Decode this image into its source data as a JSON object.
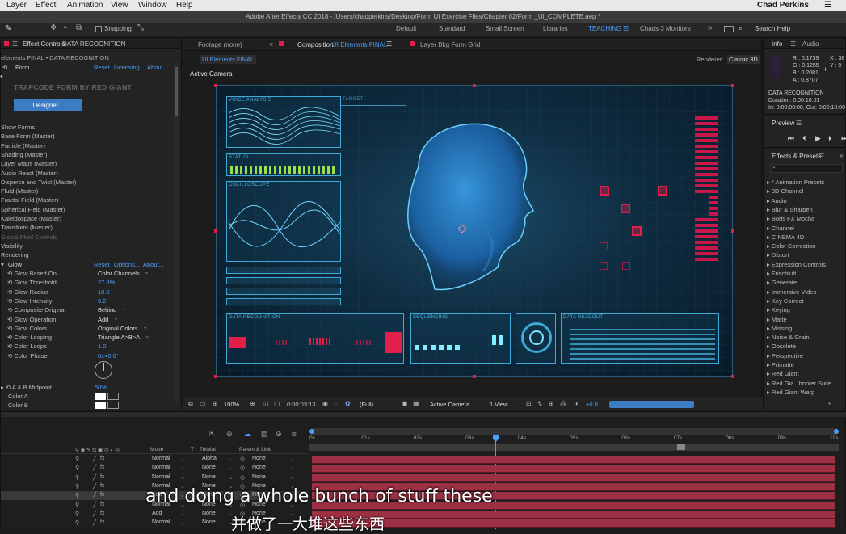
{
  "menu": [
    "Layer",
    "Effect",
    "Animation",
    "View",
    "Window",
    "Help"
  ],
  "user": "Chad Perkins",
  "title": "Adobe After Effects CC 2018 - /Users/chadperkins/Desktop/Form UI Exercise Files/Chapter 02/Form _Ui_COMPLETE.aep *",
  "toolbar": {
    "snapping": "Snapping",
    "workspaces": [
      "Default",
      "Standard",
      "Small Screen",
      "Libraries",
      "TEACHING",
      "Chads 3 Monitors"
    ],
    "active_workspace": "TEACHING",
    "search": "Search Help"
  },
  "effect_controls": {
    "tab": "Effect Controls",
    "tab_comp": "DATA RECOGNITION",
    "breadcrumb": "elements FINAL • DATA RECOGNITION",
    "effect": "Form",
    "links": [
      "Reset",
      "Licensing...",
      "About..."
    ],
    "plugin_title": "TRAPCODE FORM BY RED GIANT",
    "designer": "Designer...",
    "groups": [
      "Show Forms",
      "Base Form (Master)",
      "Particle (Master)",
      "Shading (Master)",
      "Layer Maps (Master)",
      "Audio React (Master)",
      "Disperse and Twist (Master)",
      "Fluid (Master)",
      "Fractal Field (Master)",
      "Spherical Field (Master)",
      "Kaleidospace (Master)",
      "Transform (Master)",
      "Global Fluid Controls",
      "Visibility",
      "Rendering"
    ],
    "glow": "Glow",
    "glow_links": [
      "Reset",
      "Options...",
      "About..."
    ],
    "glow_props": [
      {
        "name": "Glow Based On",
        "value": "Color Channels",
        "kind": "dd"
      },
      {
        "name": "Glow Threshold",
        "value": "27.8%",
        "kind": "num"
      },
      {
        "name": "Glow Radius",
        "value": "10.0",
        "kind": "num"
      },
      {
        "name": "Glow Intensity",
        "value": "0.2",
        "kind": "num"
      },
      {
        "name": "Composite Original",
        "value": "Behind",
        "kind": "dd"
      },
      {
        "name": "Glow Operation",
        "value": "Add",
        "kind": "dd"
      },
      {
        "name": "Glow Colors",
        "value": "Original Colors",
        "kind": "dd"
      },
      {
        "name": "Color Looping",
        "value": "Triangle A>B>A",
        "kind": "dd"
      },
      {
        "name": "Color Loops",
        "value": "1.0",
        "kind": "num"
      },
      {
        "name": "Color Phase",
        "value": "0x+0.0°",
        "kind": "num"
      }
    ],
    "ab_midpoint": {
      "name": "A & B Midpoint",
      "value": "50%"
    },
    "color_a": "Color A",
    "color_b": "Color B"
  },
  "comp": {
    "tabs": [
      "Footage (none)",
      "Composition",
      "Layer Bkg Form Grid"
    ],
    "comp_name": "UI Elements FINAL",
    "sub_tab": "UI Elements FINAL",
    "renderer_label": "Renderer:",
    "renderer": "Classic 3D",
    "camera_label": "Active Camera",
    "hud": {
      "voice": "VOICE ANALYSIS",
      "target": "TARGET",
      "status": "STATUS",
      "oscilloscope": "OSCILLOSCOPE",
      "data_recognition": "DATA RECOGNITION",
      "sequencing": "SEQUENCING",
      "data_readout": "DATA READOUT"
    },
    "footer": {
      "zoom": "100%",
      "time": "0:00:03:13",
      "resolution": "(Full)",
      "camera": "Active Camera",
      "views": "1 View",
      "exposure": "+0.0"
    }
  },
  "info": {
    "tab_info": "Info",
    "tab_audio": "Audio",
    "r": "R :  0.1739",
    "g": "G :  0.1255",
    "b": "B :  0.2081",
    "a": "A :  0.8707",
    "x": "X : 38",
    "y": "Y : 9",
    "layer": "DATA RECOGNITION",
    "duration": "Duration: 0:00:10:01",
    "inout": "In: 0:00:00:00, Out: 0:00:10:00"
  },
  "preview": {
    "tab": "Preview"
  },
  "effects_presets": {
    "tab": "Effects & Presets",
    "search_placeholder": "",
    "items": [
      "* Animation Presets",
      "3D Channel",
      "Audio",
      "Blur & Sharpen",
      "Boris FX Mocha",
      "Channel",
      "CINEMA 4D",
      "Color Correction",
      "Distort",
      "Expression Controls",
      "Frischluft",
      "Generate",
      "Immersive Video",
      "Key Correct",
      "Keying",
      "Matte",
      "Missing",
      "Noise & Grain",
      "Obsolete",
      "Perspective",
      "Primatte",
      "Red Giant",
      "Red Gia...hooter Suite",
      "Red Giant Warp"
    ]
  },
  "timeline": {
    "col_mode": "Mode",
    "col_t": "T",
    "col_trkmat": "TrkMat",
    "col_parent": "Parent & Link",
    "ticks": [
      "0s",
      "01s",
      "02s",
      "03s",
      "04s",
      "05s",
      "06s",
      "07s",
      "08s",
      "09s",
      "10s"
    ],
    "rows": [
      {
        "mode": "Normal",
        "trkmat": "Alpha",
        "parent": "None"
      },
      {
        "mode": "Normal",
        "trkmat": "None",
        "parent": "None"
      },
      {
        "mode": "Normal",
        "trkmat": "None",
        "parent": "None"
      },
      {
        "mode": "Normal",
        "trkmat": "None",
        "parent": "None"
      },
      {
        "mode": "Add",
        "trkmat": "None",
        "parent": "None"
      },
      {
        "mode": "Normal",
        "trkmat": "None",
        "parent": "None"
      },
      {
        "mode": "Add",
        "trkmat": "None",
        "parent": "None"
      },
      {
        "mode": "Normal",
        "trkmat": "None",
        "parent": "None"
      }
    ]
  },
  "subtitle": {
    "en": "and doing a whole bunch of stuff these",
    "zh": "并做了一大堆这些东西"
  }
}
